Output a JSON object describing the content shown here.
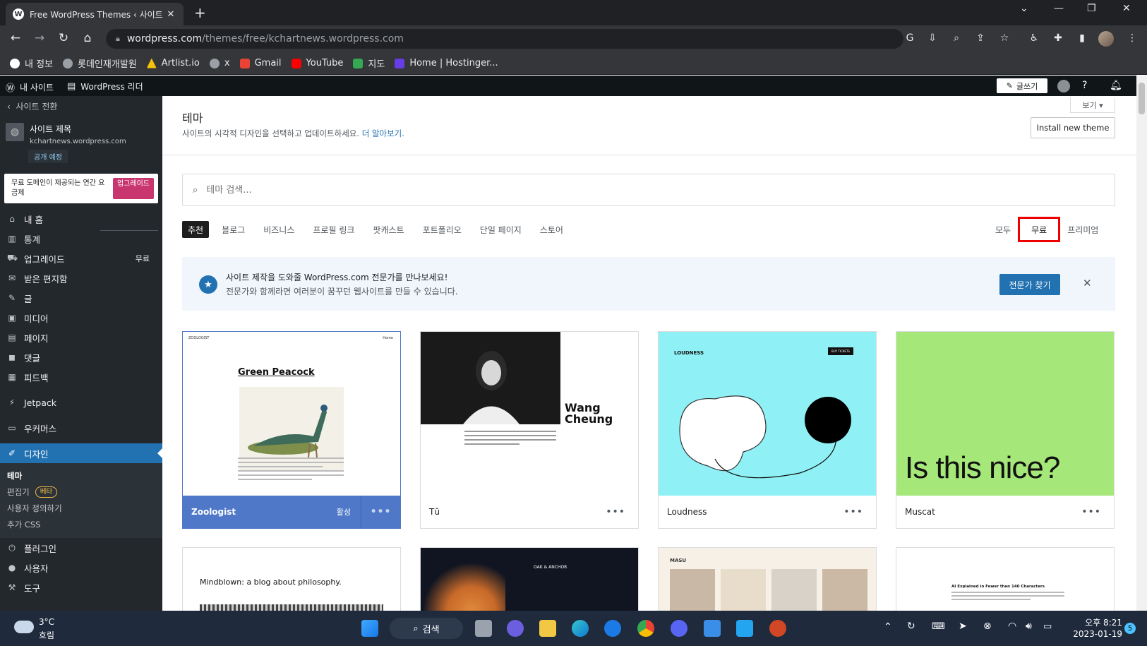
{
  "browser": {
    "tab_title": "Free WordPress Themes ‹ 사이트",
    "tab_close": "✕",
    "new_tab": "+",
    "url_host": "wordpress.com",
    "url_path": "/themes/free/kchartnews.wordpress.com",
    "bookmarks": [
      {
        "label": "내 정보",
        "color": "#ffffff"
      },
      {
        "label": "롯데인재개발원",
        "color": "#9aa0a6"
      },
      {
        "label": "Artlist.io",
        "color": "#f4c20d"
      },
      {
        "label": "x",
        "color": "#9aa0a6"
      },
      {
        "label": "Gmail",
        "color": "#ea4335"
      },
      {
        "label": "YouTube",
        "color": "#ff0000"
      },
      {
        "label": "지도",
        "color": "#34a853"
      },
      {
        "label": "Home | Hostinger...",
        "color": "#673de6"
      }
    ]
  },
  "adminbar": {
    "my_site": "내 사이트",
    "reader": "WordPress 리더",
    "write": "글쓰기"
  },
  "sidebar": {
    "switch_site": "사이트 전환",
    "site_name": "사이트 제목",
    "site_url": "kchartnews.wordpress.com",
    "badge": "공개 예정",
    "upsell_text": "무료 도메인이 제공되는 연간 요금제",
    "upsell_button": "업그레이드",
    "menu": [
      {
        "label": "내 홈",
        "icon": "home-icon"
      },
      {
        "label": "통계",
        "icon": "stats-icon"
      },
      {
        "label": "업그레이드",
        "icon": "cart-icon",
        "aside": "무료"
      },
      {
        "label": "받은 편지함",
        "icon": "mail-icon"
      },
      {
        "label": "글",
        "icon": "pin-icon"
      },
      {
        "label": "미디어",
        "icon": "media-icon"
      },
      {
        "label": "페이지",
        "icon": "page-icon"
      },
      {
        "label": "댓글",
        "icon": "comment-icon"
      },
      {
        "label": "피드백",
        "icon": "feedback-icon"
      }
    ],
    "jetpack": "Jetpack",
    "woo": "우커머스",
    "design": "디자인",
    "design_sub": [
      {
        "label": "테마"
      },
      {
        "label": "편집기",
        "badge": "베타"
      },
      {
        "label": "사용자 정의하기"
      },
      {
        "label": "추가 CSS"
      }
    ],
    "bottom_menu": [
      {
        "label": "플러그인",
        "icon": "plugin-icon"
      },
      {
        "label": "사용자",
        "icon": "user-icon"
      },
      {
        "label": "도구",
        "icon": "wrench-icon"
      }
    ]
  },
  "main": {
    "title": "테마",
    "subtitle": "사이트의 시각적 디자인을 선택하고 업데이트하세요.",
    "learn_more": "더 알아보기.",
    "view": "보기 ▾",
    "install_button": "Install new theme",
    "search_placeholder": "테마 검색...",
    "filters": [
      "추천",
      "블로그",
      "비즈니스",
      "프로필 링크",
      "팟캐스트",
      "포트폴리오",
      "단일 페이지",
      "스토어"
    ],
    "tiers": [
      "모두",
      "무료",
      "프리미엄"
    ],
    "banner_line1": "사이트 제작을 도와줄 WordPress.com 전문가를 만나보세요!",
    "banner_line2": "전문가와 함께라면 여러분이 꿈꾸던 웹사이트를 만들 수 있습니다.",
    "banner_cta": "전문가 찾기",
    "themes": [
      {
        "name": "Zoologist",
        "status": "활성",
        "preview_heading": "Green Peacock",
        "preview_brand": "ZOOLOGIST",
        "preview_nav": "Home"
      },
      {
        "name": "Tŭ",
        "preview_heading": "Wang Cheung"
      },
      {
        "name": "Loudness",
        "preview_brand": "LOUDNESS",
        "preview_cta": "BUY TICKETS"
      },
      {
        "name": "Muscat",
        "preview_heading": "Is this nice?"
      }
    ],
    "themes_row2": [
      {
        "preview_heading": "Mindblown: a blog about philosophy."
      },
      {
        "preview_brand": "OAK & ANCHOR"
      },
      {
        "preview_brand": "MASU"
      },
      {
        "preview_heading": "AI Explained in Fewer than 140 Characters"
      }
    ]
  },
  "taskbar": {
    "temp": "3°C",
    "weather": "흐림",
    "search": "검색",
    "time": "오후 8:21",
    "date": "2023-01-19",
    "notif_count": "5"
  }
}
